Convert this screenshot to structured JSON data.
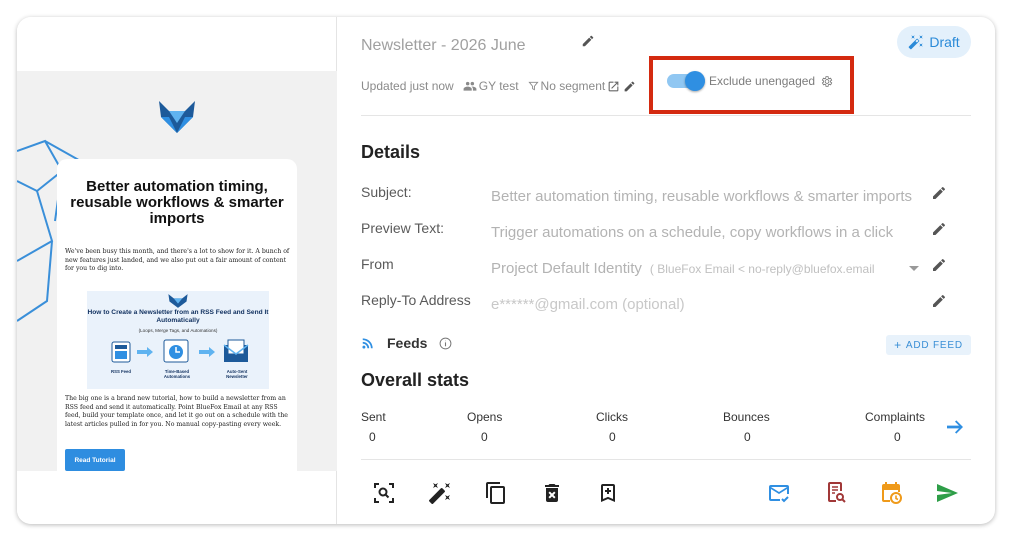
{
  "preview": {
    "email_title": "Better automation timing, reusable workflows & smarter imports",
    "intro": "We've been busy this month, and there's a lot to show for it. A bunch of new features just landed, and we also put out a fair amount of content for you to dig into.",
    "figure": {
      "title": "How to Create a Newsletter from an RSS Feed and Send It Automatically",
      "subtitle": "(Loops, Merge Tags, and Automations)",
      "steps": [
        "RSS Feed",
        "Time-Based Automations",
        "Auto-Sent Newsletter"
      ]
    },
    "body": "The big one is a brand new tutorial, how to build a newsletter from an RSS feed and send it automatically. Point BlueFox Email at any RSS feed, build your template once, and let it go out on a schedule with the latest articles pulled in for you. No manual copy-pasting every week.",
    "cta_label": "Read Tutorial"
  },
  "header": {
    "title": "Newsletter - 2026 June",
    "status_badge": "Draft",
    "updated": "Updated just now",
    "audience": "GY test",
    "segment": "No segment",
    "toggle": {
      "label": "Exclude unengaged",
      "on": true
    }
  },
  "details": {
    "heading": "Details",
    "subject_label": "Subject:",
    "subject_value": "Better automation timing, reusable workflows & smarter imports",
    "preview_label": "Preview Text:",
    "preview_value": "Trigger automations on a schedule, copy workflows in a click",
    "from_label": "From",
    "from_value": "Project Default Identity",
    "from_extra": "( BlueFox Email < no-reply@bluefox.email",
    "reply_label": "Reply-To Address",
    "reply_placeholder": "e******@gmail.com (optional)"
  },
  "feeds": {
    "label": "Feeds",
    "add_label": "ADD FEED"
  },
  "stats": {
    "heading": "Overall stats",
    "items": [
      {
        "label": "Sent",
        "value": "0"
      },
      {
        "label": "Opens",
        "value": "0"
      },
      {
        "label": "Clicks",
        "value": "0"
      },
      {
        "label": "Bounces",
        "value": "0"
      },
      {
        "label": "Complaints",
        "value": "0"
      }
    ]
  },
  "toolbar": {
    "icons": [
      "preview-search-icon",
      "magic-wand-icon",
      "copy-icon",
      "delete-icon",
      "bookmark-add-icon",
      "test-email-icon",
      "review-icon",
      "schedule-icon",
      "send-icon"
    ]
  },
  "colors": {
    "accent": "#2f8fe2",
    "highlight": "#d42a10",
    "send": "#2e9e48",
    "schedule": "#ef9a1a",
    "review": "#a13838"
  }
}
